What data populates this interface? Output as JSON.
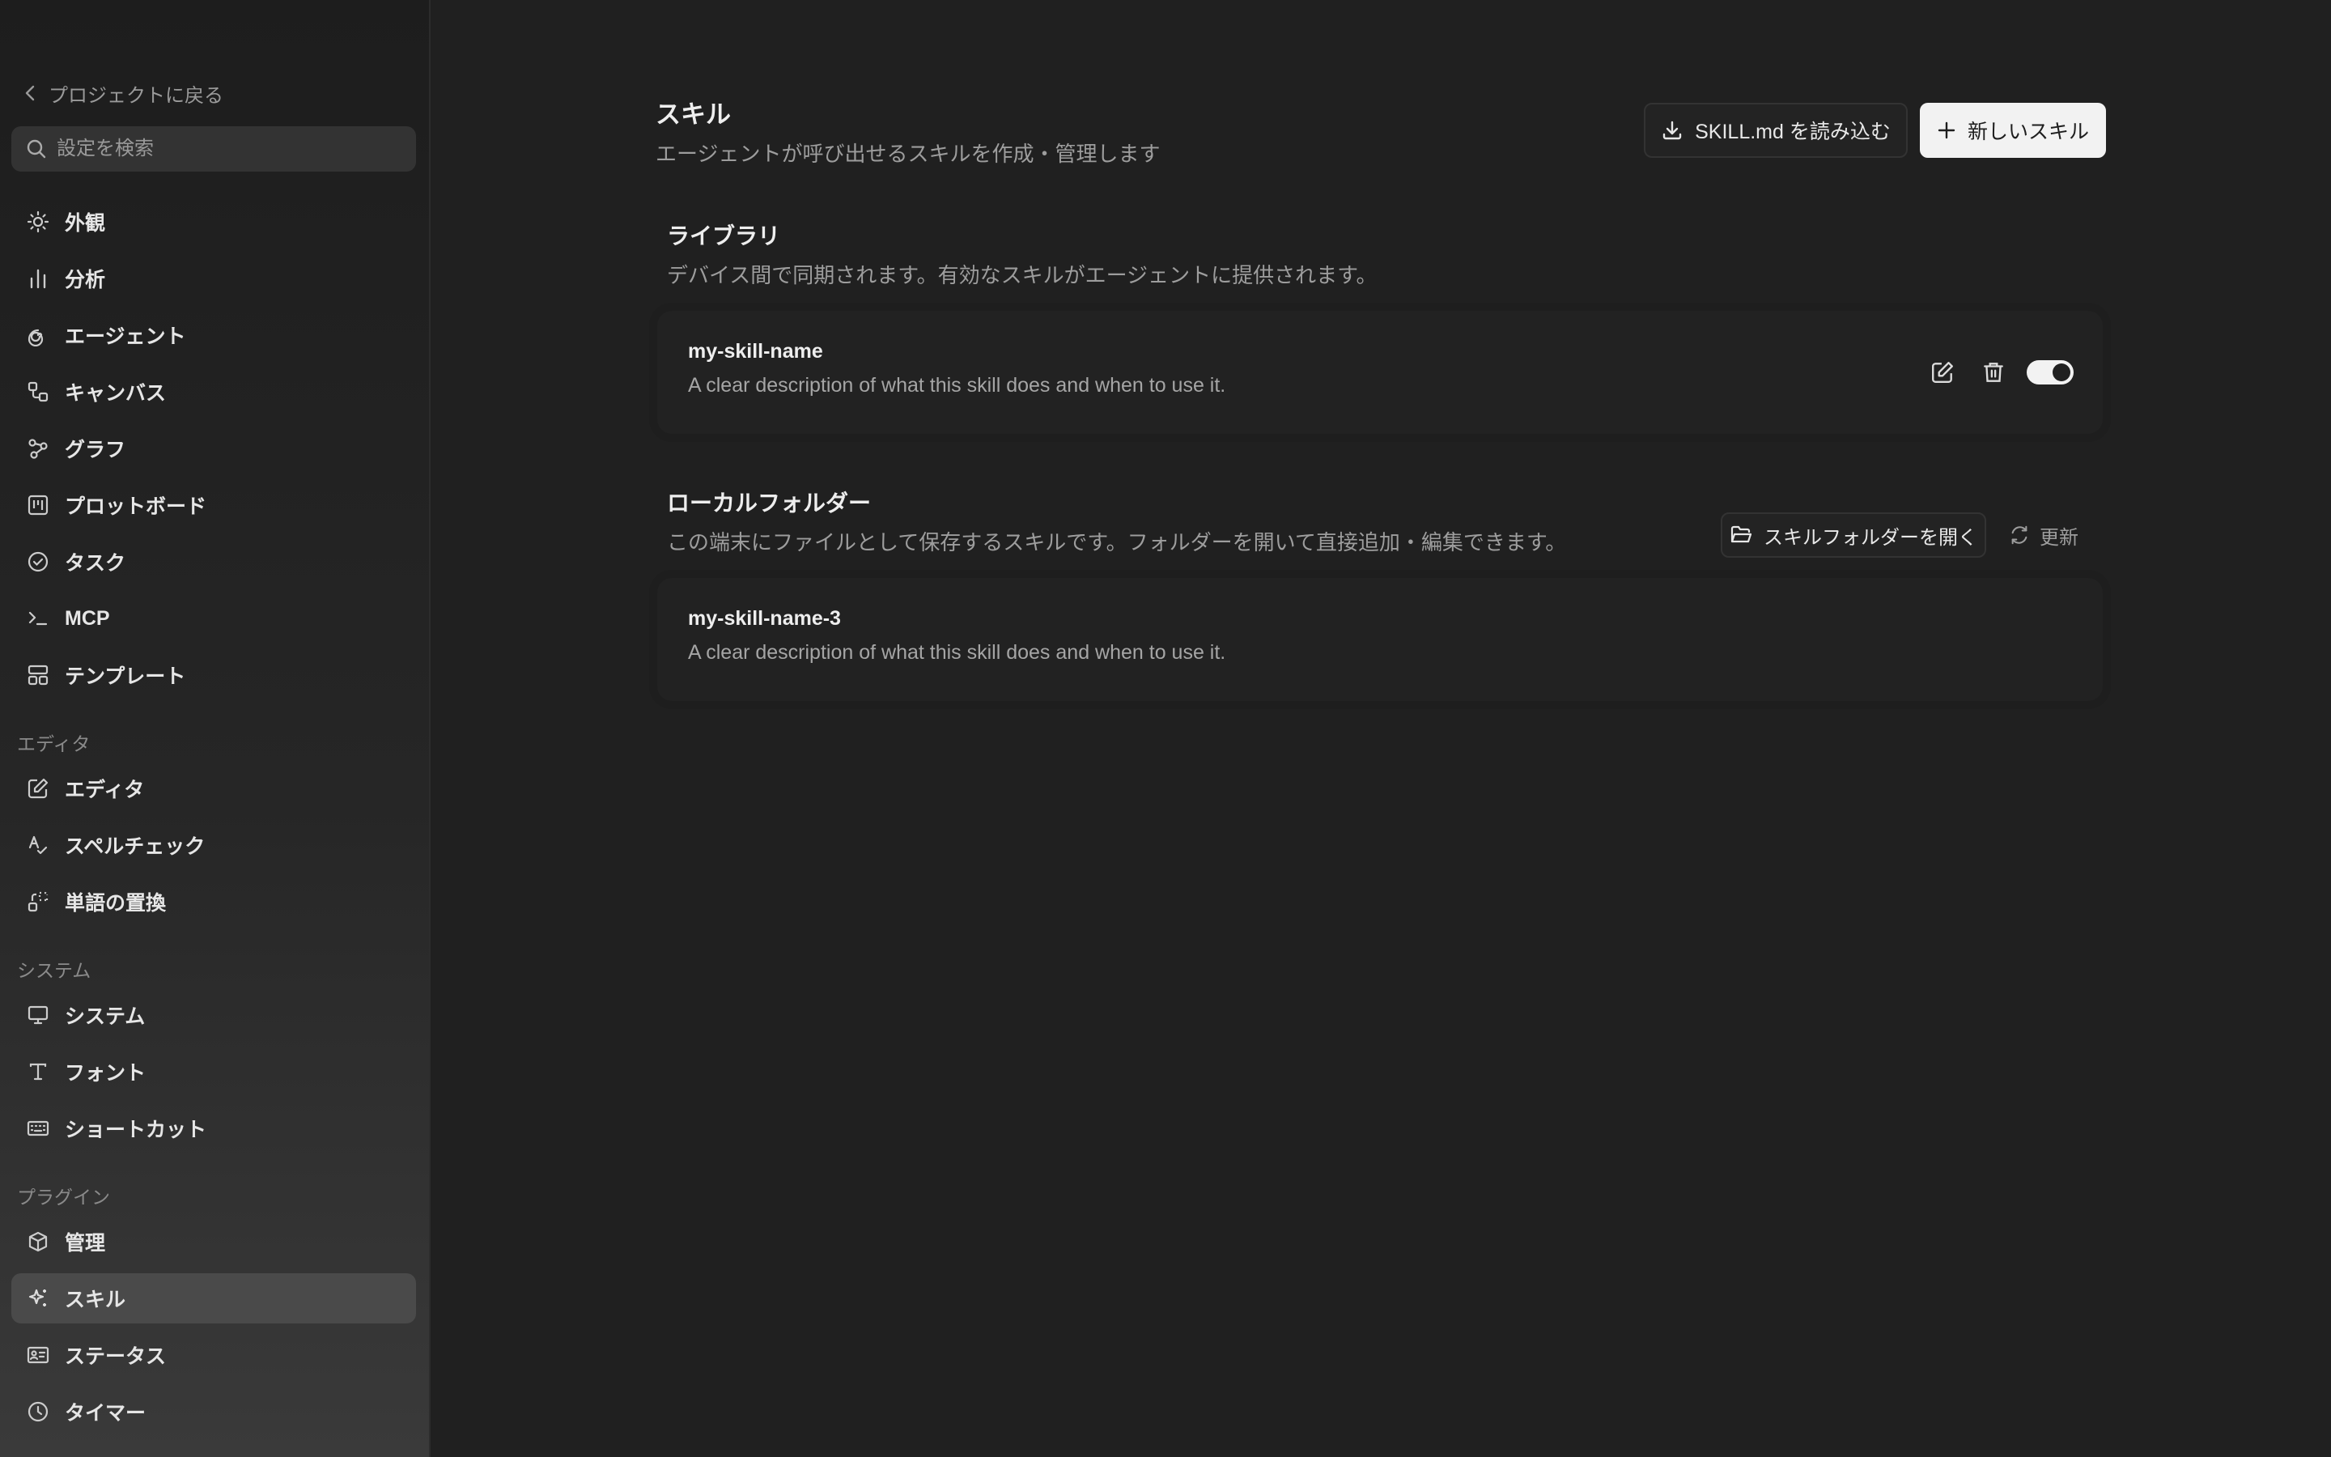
{
  "sidebar": {
    "back_label": "プロジェクトに戻る",
    "search_placeholder": "設定を検索",
    "items_top": [
      {
        "label": "外観",
        "icon": "sun-icon"
      },
      {
        "label": "分析",
        "icon": "bar-chart-icon"
      },
      {
        "label": "エージェント",
        "icon": "spiral-icon"
      },
      {
        "label": "キャンバス",
        "icon": "canvas-icon"
      },
      {
        "label": "グラフ",
        "icon": "graph-icon"
      },
      {
        "label": "プロットボード",
        "icon": "kanban-icon"
      },
      {
        "label": "タスク",
        "icon": "check-circle-icon"
      },
      {
        "label": "MCP",
        "icon": "terminal-icon"
      },
      {
        "label": "テンプレート",
        "icon": "layout-icon"
      }
    ],
    "editor_section": "エディタ",
    "items_editor": [
      {
        "label": "エディタ",
        "icon": "edit-icon"
      },
      {
        "label": "スペルチェック",
        "icon": "spellcheck-icon"
      },
      {
        "label": "単語の置換",
        "icon": "replace-icon"
      }
    ],
    "system_section": "システム",
    "items_system": [
      {
        "label": "システム",
        "icon": "monitor-icon"
      },
      {
        "label": "フォント",
        "icon": "type-icon"
      },
      {
        "label": "ショートカット",
        "icon": "keyboard-icon"
      }
    ],
    "plugin_section": "プラグイン",
    "items_plugin": [
      {
        "label": "管理",
        "icon": "box-icon"
      },
      {
        "label": "スキル",
        "icon": "sparkles-icon",
        "active": true
      },
      {
        "label": "ステータス",
        "icon": "id-card-icon"
      },
      {
        "label": "タイマー",
        "icon": "clock-icon"
      }
    ]
  },
  "main": {
    "title": "スキル",
    "subtitle": "エージェントが呼び出せるスキルを作成・管理します",
    "import_label": "SKILL.md を読み込む",
    "new_label": "新しいスキル",
    "library": {
      "title": "ライブラリ",
      "subtitle": "デバイス間で同期されます。有効なスキルがエージェントに提供されます。",
      "skills": [
        {
          "name": "my-skill-name",
          "description": "A clear description of what this skill does and when to use it.",
          "enabled": true
        }
      ]
    },
    "local": {
      "title": "ローカルフォルダー",
      "subtitle": "この端末にファイルとして保存するスキルです。フォルダーを開いて直接追加・編集できます。",
      "open_folder_label": "スキルフォルダーを開く",
      "refresh_label": "更新",
      "skills": [
        {
          "name": "my-skill-name-3",
          "description": "A clear description of what this skill does and when to use it."
        }
      ]
    }
  },
  "colors": {
    "background": "#202020",
    "sidebar_active": "#4a4a4a",
    "primary_button": "#f2f2f2",
    "muted_text": "#9d9d9d"
  }
}
